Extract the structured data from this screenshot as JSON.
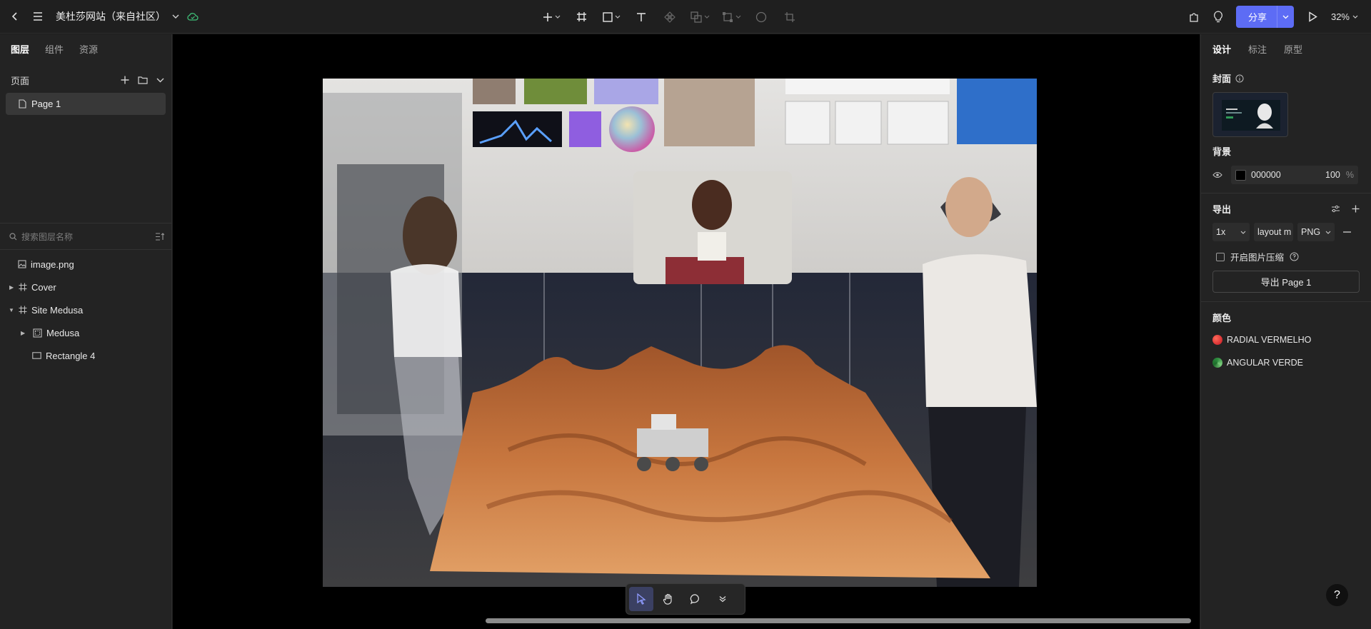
{
  "app": {
    "doc_title": "美杜莎网站（来自社区）",
    "share_label": "分享",
    "zoom_label": "32%"
  },
  "left_panel": {
    "tabs": [
      {
        "label": "图层"
      },
      {
        "label": "组件"
      },
      {
        "label": "资源"
      }
    ],
    "pages_header": "页面",
    "pages": [
      {
        "label": "Page 1"
      }
    ],
    "search_placeholder": "搜索图层名称",
    "layers": [
      {
        "label": "image.png",
        "icon": "image-icon"
      },
      {
        "label": "Cover",
        "icon": "frame-icon"
      },
      {
        "label": "Site Medusa",
        "icon": "frame-icon"
      },
      {
        "label": "Medusa",
        "icon": "component-icon"
      },
      {
        "label": "Rectangle 4",
        "icon": "rectangle-icon"
      }
    ]
  },
  "right_panel": {
    "tabs": [
      {
        "label": "设计"
      },
      {
        "label": "标注"
      },
      {
        "label": "原型"
      }
    ],
    "cover_label": "封面",
    "background_label": "背景",
    "background_hex": "000000",
    "background_opacity": "100",
    "percent_sign": "%",
    "export_label": "导出",
    "export_scale": "1x",
    "export_suffix": "layout m",
    "export_format": "PNG",
    "compress_label": "开启图片压缩",
    "export_button": "导出 Page 1",
    "colors_label": "颜色",
    "colors": [
      {
        "label": "RADIAL VERMELHO",
        "color": "#e0282a"
      },
      {
        "label": "ANGULAR VERDE",
        "color": "#2e8b3e"
      }
    ]
  },
  "help_label": "?"
}
